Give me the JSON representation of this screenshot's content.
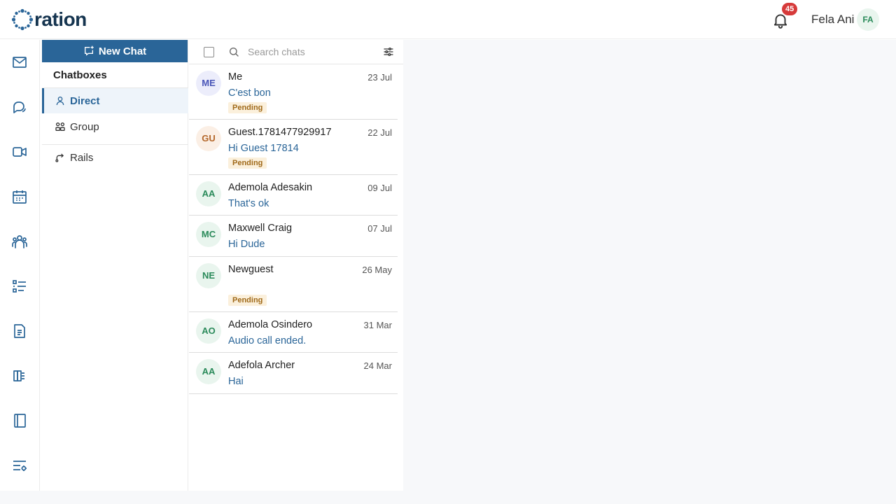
{
  "header": {
    "logo_text": "ration",
    "notification_count": "45",
    "user_name": "Fela Ani",
    "user_initials": "FA"
  },
  "rail": {
    "icons": [
      "mail-icon",
      "chat-icon",
      "video-icon",
      "calendar-icon",
      "people-icon",
      "list-icon",
      "document-icon",
      "book-icon",
      "notebook-icon",
      "settings-list-icon"
    ]
  },
  "panel": {
    "new_chat_label": "New Chat",
    "section_title": "Chatboxes",
    "items": [
      {
        "label": "Direct",
        "icon": "person-icon",
        "active": true
      },
      {
        "label": "Group",
        "icon": "group-icon",
        "active": false
      },
      {
        "label": "Rails",
        "icon": "rails-icon",
        "active": false
      }
    ]
  },
  "search": {
    "placeholder": "Search chats",
    "value": ""
  },
  "chats": [
    {
      "initials": "ME",
      "name": "Me",
      "date": "23 Jul",
      "preview": "C'est bon",
      "pending": "Pending",
      "avatar_bg": "#ecedfb",
      "avatar_fg": "#4a56b8"
    },
    {
      "initials": "GU",
      "name": "Guest.1781477929917",
      "date": "22 Jul",
      "preview": "Hi Guest 17814",
      "pending": "Pending",
      "avatar_bg": "#fbefe5",
      "avatar_fg": "#b4672a"
    },
    {
      "initials": "AA",
      "name": "Ademola Adesakin",
      "date": "09 Jul",
      "preview": "That's ok",
      "pending": "",
      "avatar_bg": "#e9f5ee",
      "avatar_fg": "#2a8a5a"
    },
    {
      "initials": "MC",
      "name": "Maxwell Craig",
      "date": "07 Jul",
      "preview": "Hi Dude",
      "pending": "",
      "avatar_bg": "#e9f5ee",
      "avatar_fg": "#2a8a5a"
    },
    {
      "initials": "NE",
      "name": "Newguest",
      "date": "26 May",
      "preview": "",
      "pending": "Pending",
      "avatar_bg": "#e9f5ee",
      "avatar_fg": "#2a8a5a"
    },
    {
      "initials": "AO",
      "name": "Ademola Osindero",
      "date": "31 Mar",
      "preview": "Audio call ended.",
      "pending": "",
      "avatar_bg": "#e9f5ee",
      "avatar_fg": "#2a8a5a"
    },
    {
      "initials": "AA",
      "name": "Adefola Archer",
      "date": "24 Mar",
      "preview": "Hai",
      "pending": "",
      "avatar_bg": "#e9f5ee",
      "avatar_fg": "#2a8a5a"
    }
  ]
}
